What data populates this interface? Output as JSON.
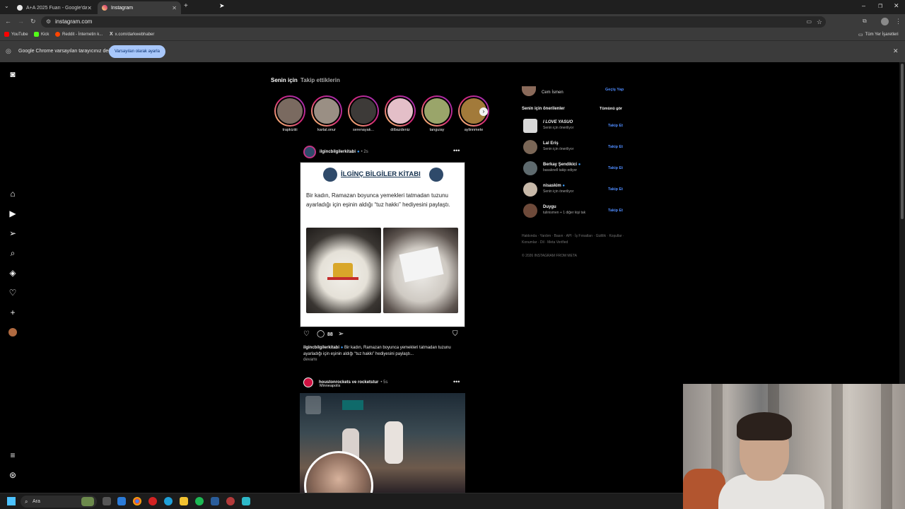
{
  "browser": {
    "tabs": [
      {
        "title": "A+A 2025 Fuarı - Google'da Ar",
        "active": false
      },
      {
        "title": "Instagram",
        "active": true
      }
    ],
    "url": "instagram.com",
    "bookmarks": [
      "YouTube",
      "Kick",
      "Reddit - İnternetin k...",
      "x.com/darkwebhaber"
    ],
    "all_bookmarks": "Tüm Yer İşaretleri",
    "infobar": {
      "message": "Google Chrome varsayılan tarayıcınız değil",
      "button": "Varsayılan olarak ayarla"
    }
  },
  "feed": {
    "tabs": [
      "Senin için",
      "Takip ettiklerin"
    ],
    "stories": [
      "trapkiziiii",
      "kartal.onur",
      "serenayak...",
      "dilbazdeniz",
      "tanguiay",
      "aylinnmete"
    ]
  },
  "post1": {
    "username": "ilgincbilgilerkitabi",
    "time": "• 2s",
    "image_title": "İLGİNÇ BİLGİLER KİTABI",
    "image_text": "Bir kadın, Ramazan boyunca yemekleri tatmadan tuzunu ayarladığı için eşinin aldığı “tuz hakkı” hediyesini paylaştı.",
    "comments": "88",
    "caption_user": "ilgincbilgilerkitabi",
    "caption": "Bir kadın, Ramazan boyunca yemekleri tatmadan tuzunu ayarladığı için eşinin aldığı “tuz hakkı” hediyesini paylaştı...",
    "more": "devamı"
  },
  "post2": {
    "username": "houstonrockets ve rocketstur",
    "time": "• 5s",
    "location": "Minneapolis"
  },
  "sidebar": {
    "current_user": "Cem İsmen",
    "switch": "Geçiş Yap",
    "suggestions_title": "Senin için önerilenler",
    "see_all": "Tümünü gör",
    "follow_label": "Takip Et",
    "suggestions": [
      {
        "name": "I LOVE YASUO",
        "sub": "Senin için öneriliyor"
      },
      {
        "name": "Lal Eriş",
        "sub": "Senin için öneriliyor"
      },
      {
        "name": "Berkay Şendikici",
        "sub": "basaknell takip ediyor"
      },
      {
        "name": "nisaskim",
        "sub": "Senin için öneriliyor"
      },
      {
        "name": "Duygu",
        "sub": "tulinismen + 1 diğer kişi tak"
      }
    ],
    "footer_links": "Hakkında · Yardım · Basın · API · İş Fırsatları · Gizlilik · Koşullar · Konumlar · Dil · Meta Verified",
    "copyright": "© 2026 INSTAGRAM FROM META"
  },
  "taskbar": {
    "search": "Ara"
  },
  "colors": {
    "accent": "#4f8cff",
    "story_ring": "#d62976",
    "background": "#000000"
  }
}
